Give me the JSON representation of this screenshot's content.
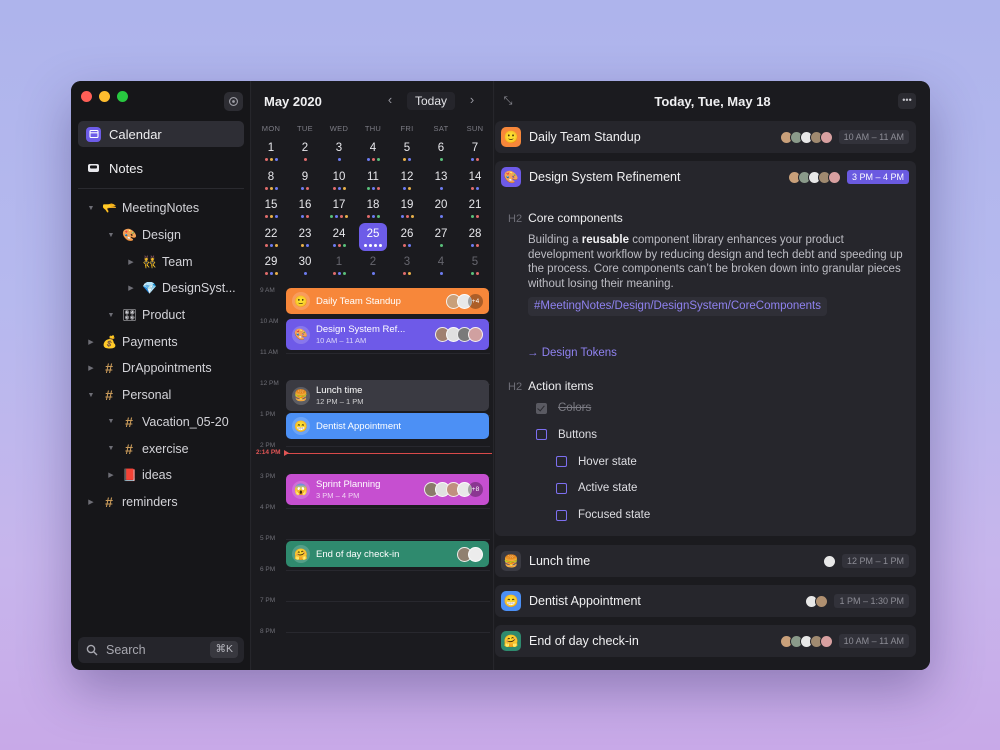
{
  "sidebar": {
    "nav": [
      {
        "label": "Calendar",
        "icon": "calendar-icon",
        "active": true
      },
      {
        "label": "Notes",
        "icon": "inbox-icon",
        "active": false
      }
    ],
    "tree": [
      {
        "label": "MeetingNotes",
        "icon": "🫳",
        "depth": 0,
        "caret": "▼"
      },
      {
        "label": "Design",
        "icon": "🎨",
        "depth": 1,
        "caret": "▼"
      },
      {
        "label": "Team",
        "icon": "👯",
        "depth": 2,
        "caret": "▶"
      },
      {
        "label": "DesignSyst...",
        "icon": "💎",
        "depth": 2,
        "caret": "▶"
      },
      {
        "label": "Product",
        "icon": "🎛",
        "depth": 1,
        "caret": "▼"
      },
      {
        "label": "Payments",
        "icon": "💰",
        "depth": 0,
        "caret": "▶"
      },
      {
        "label": "DrAppointments",
        "icon": "#",
        "depth": 0,
        "caret": "▶"
      },
      {
        "label": "Personal",
        "icon": "#",
        "depth": 0,
        "caret": "▼"
      },
      {
        "label": "Vacation_05-20",
        "icon": "#",
        "depth": 1,
        "caret": "▼"
      },
      {
        "label": "exercise",
        "icon": "#",
        "depth": 1,
        "caret": "▼"
      },
      {
        "label": "ideas",
        "icon": "📕",
        "depth": 1,
        "caret": "▶"
      },
      {
        "label": "reminders",
        "icon": "#",
        "depth": 0,
        "caret": "▶"
      }
    ],
    "search_label": "Search",
    "search_shortcut": "⌘K"
  },
  "calendar": {
    "month_label": "May 2020",
    "prev_label": "‹",
    "today_label": "Today",
    "next_label": "›",
    "weekdays": [
      "MON",
      "TUE",
      "WED",
      "THU",
      "FRI",
      "SAT",
      "SUN"
    ],
    "weeks": [
      [
        {
          "d": "1",
          "c": [
            "#e06c6c",
            "#e8b04a",
            "#6d7cf0"
          ]
        },
        {
          "d": "2",
          "c": [
            "#e06c6c"
          ]
        },
        {
          "d": "3",
          "c": [
            "#6d7cf0"
          ]
        },
        {
          "d": "4",
          "c": [
            "#6d7cf0",
            "#e06c6c",
            "#5ac07a"
          ]
        },
        {
          "d": "5",
          "c": [
            "#e8b04a",
            "#6d7cf0"
          ]
        },
        {
          "d": "6",
          "c": [
            "#5ac07a"
          ]
        },
        {
          "d": "7",
          "c": [
            "#6d7cf0",
            "#e06c6c"
          ]
        }
      ],
      [
        {
          "d": "8",
          "c": [
            "#e06c6c",
            "#e8b04a",
            "#6d7cf0"
          ]
        },
        {
          "d": "9",
          "c": [
            "#6d7cf0",
            "#e06c6c"
          ]
        },
        {
          "d": "10",
          "c": [
            "#e06c6c",
            "#6d7cf0",
            "#e8b04a"
          ]
        },
        {
          "d": "11",
          "c": [
            "#5ac07a",
            "#6d7cf0",
            "#e06c6c"
          ]
        },
        {
          "d": "12",
          "c": [
            "#6d7cf0",
            "#e8b04a"
          ]
        },
        {
          "d": "13",
          "c": [
            "#6d7cf0"
          ]
        },
        {
          "d": "14",
          "c": [
            "#e06c6c",
            "#6d7cf0"
          ]
        }
      ],
      [
        {
          "d": "15",
          "c": [
            "#e06c6c",
            "#e8b04a",
            "#6d7cf0"
          ]
        },
        {
          "d": "16",
          "c": [
            "#6d7cf0",
            "#e06c6c"
          ]
        },
        {
          "d": "17",
          "c": [
            "#5ac07a",
            "#6d7cf0",
            "#e06c6c",
            "#e8b04a"
          ]
        },
        {
          "d": "18",
          "c": [
            "#e06c6c",
            "#6d7cf0",
            "#5ac07a"
          ]
        },
        {
          "d": "19",
          "c": [
            "#6d7cf0",
            "#e06c6c",
            "#e8b04a"
          ]
        },
        {
          "d": "20",
          "c": [
            "#6d7cf0"
          ]
        },
        {
          "d": "21",
          "c": [
            "#5ac07a",
            "#e06c6c"
          ]
        }
      ],
      [
        {
          "d": "22",
          "c": [
            "#e06c6c",
            "#6d7cf0",
            "#e8b04a"
          ]
        },
        {
          "d": "23",
          "c": [
            "#e8b04a",
            "#6d7cf0"
          ]
        },
        {
          "d": "24",
          "c": [
            "#6d7cf0",
            "#e06c6c",
            "#5ac07a"
          ]
        },
        {
          "d": "25",
          "c": [
            "#ffffff",
            "#ffffff",
            "#ffffff",
            "#ffffff"
          ],
          "sel": true
        },
        {
          "d": "26",
          "c": [
            "#e06c6c",
            "#6d7cf0"
          ]
        },
        {
          "d": "27",
          "c": [
            "#5ac07a"
          ]
        },
        {
          "d": "28",
          "c": [
            "#6d7cf0",
            "#e06c6c"
          ]
        }
      ],
      [
        {
          "d": "29",
          "c": [
            "#e06c6c",
            "#6d7cf0",
            "#e8b04a"
          ]
        },
        {
          "d": "30",
          "c": [
            "#6d7cf0"
          ]
        },
        {
          "d": "1",
          "c": [
            "#e06c6c",
            "#6d7cf0",
            "#5ac07a"
          ],
          "dim": true
        },
        {
          "d": "2",
          "c": [
            "#6d7cf0"
          ],
          "dim": true
        },
        {
          "d": "3",
          "c": [
            "#e06c6c",
            "#e8b04a"
          ],
          "dim": true
        },
        {
          "d": "4",
          "c": [
            "#6d7cf0"
          ],
          "dim": true
        },
        {
          "d": "5",
          "c": [
            "#5ac07a",
            "#e06c6c"
          ],
          "dim": true
        }
      ]
    ],
    "hours": [
      "9 AM",
      "10 AM",
      "11 AM",
      "12 PM",
      "1 PM",
      "2 PM",
      "3 PM",
      "4 PM",
      "5 PM",
      "6 PM",
      "7 PM",
      "8 PM"
    ],
    "now_label": "2:14 PM",
    "events": [
      {
        "title": "Daily Team Standup",
        "time": "",
        "emoji": "🙂",
        "color": "#f7873a",
        "extra": "+4",
        "av": [
          "#c9a07a",
          "#e8e8e8"
        ]
      },
      {
        "title": "Design System Ref...",
        "time": "10 AM – 11 AM",
        "emoji": "🎨",
        "color": "#6e5ae8",
        "extra": "",
        "av": [
          "#a08070",
          "#e0e0e0",
          "#7a7a7a",
          "#d0a0a0"
        ]
      },
      {
        "title": "Lunch time",
        "time": "12 PM – 1 PM",
        "emoji": "🍔",
        "color": "#3a3a42",
        "extra": "",
        "av": []
      },
      {
        "title": "Dentist Appointment",
        "time": "",
        "emoji": "😁",
        "color": "#4c90f5",
        "extra": "",
        "av": []
      },
      {
        "title": "Sprint Planning",
        "time": "3 PM – 4 PM",
        "emoji": "😱",
        "color": "#c64fd0",
        "extra": "+8",
        "av": [
          "#8a7a6a",
          "#e0e0e0",
          "#c09080",
          "#e8e8e8"
        ]
      },
      {
        "title": "End of day check-in",
        "time": "",
        "emoji": "🤗",
        "color": "#2f8a6e",
        "extra": "",
        "av": [
          "#908070",
          "#ececec"
        ]
      }
    ]
  },
  "detail": {
    "expand_label": "⤡",
    "date_label": "Today, Tue, May 18",
    "more_label": "•••",
    "cards": [
      {
        "title": "Daily Team Standup",
        "emoji": "🙂",
        "emoji_bg": "#f7873a",
        "time": "10 AM – 11 AM",
        "highlight": false,
        "av": [
          "#c9a07a",
          "#8a9a8a",
          "#e8e8e8",
          "#a08a70",
          "#d8a0a0"
        ]
      },
      {
        "title": "Design System Refinement",
        "emoji": "🎨",
        "emoji_bg": "#6e5ae8",
        "time": "3 PM – 4 PM",
        "highlight": true,
        "av": [
          "#c9a07a",
          "#8a9a8a",
          "#e8e8e8",
          "#a08a70",
          "#d8a0a0"
        ]
      },
      {
        "title": "Lunch time",
        "emoji": "🍔",
        "emoji_bg": "#3a3a42",
        "time": "12 PM – 1 PM",
        "highlight": false,
        "av": [
          "#e8e8e8"
        ]
      },
      {
        "title": "Dentist Appointment",
        "emoji": "😁",
        "emoji_bg": "#4c90f5",
        "time": "1 PM – 1:30 PM",
        "highlight": false,
        "av": [
          "#e8e8e8",
          "#b09070"
        ]
      },
      {
        "title": "End of day check-in",
        "emoji": "🤗",
        "emoji_bg": "#2f8a6e",
        "time": "10 AM – 11 AM",
        "highlight": false,
        "av": [
          "#c9a07a",
          "#8a9a8a",
          "#e8e8e8",
          "#a08a70",
          "#d8a0a0"
        ]
      }
    ],
    "h2_tag": "H2",
    "core_heading": "Core components",
    "para_before": "Building a ",
    "para_bold": "reusable",
    "para_after": " component library enhances your product development workflow by reducing design and tech debt and speeding up the process. Core components can’t be broken down into granular pieces without losing their meaning.",
    "tag_link": "#MeetingNotes/Design/DesignSystem/CoreComponents",
    "design_tokens": "Design Tokens",
    "action_heading": "Action items",
    "checklist": [
      {
        "label": "Colors",
        "done": true,
        "indent": 0
      },
      {
        "label": "Buttons",
        "done": false,
        "indent": 0
      },
      {
        "label": "Hover state",
        "done": false,
        "indent": 1
      },
      {
        "label": "Active state",
        "done": false,
        "indent": 1
      },
      {
        "label": "Focused state",
        "done": false,
        "indent": 1
      }
    ]
  }
}
